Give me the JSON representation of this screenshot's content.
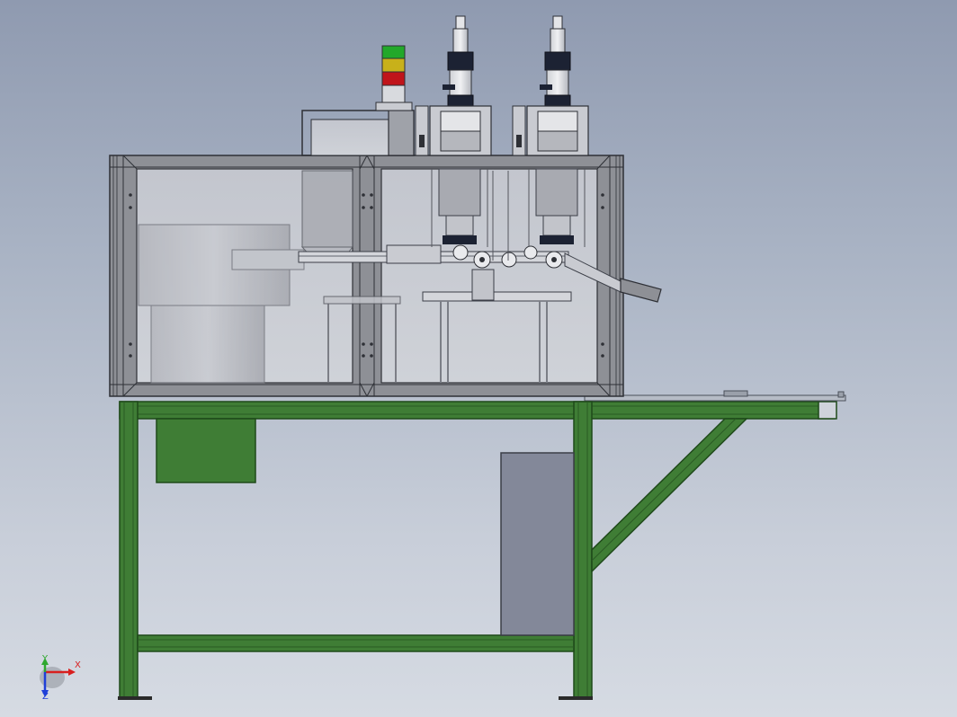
{
  "viewport": {
    "background_top": "#8f9ab0",
    "background_bottom": "#d6dbe3"
  },
  "colors": {
    "frame_green": "#3f7d35",
    "frame_green_dark": "#1f4a1a",
    "enclosure_gray": "#8e9096",
    "glass": "#c9ccd3",
    "tower_green": "#22a82a",
    "tower_yellow": "#c8b11a",
    "tower_red": "#c0141a",
    "cabinet_gray": "#838899"
  },
  "triad": {
    "x_label": "X",
    "y_label": "Y",
    "z_label": "Z",
    "x_color": "#d81f1f",
    "y_color": "#2fa82f",
    "z_color": "#1f3fd8"
  }
}
